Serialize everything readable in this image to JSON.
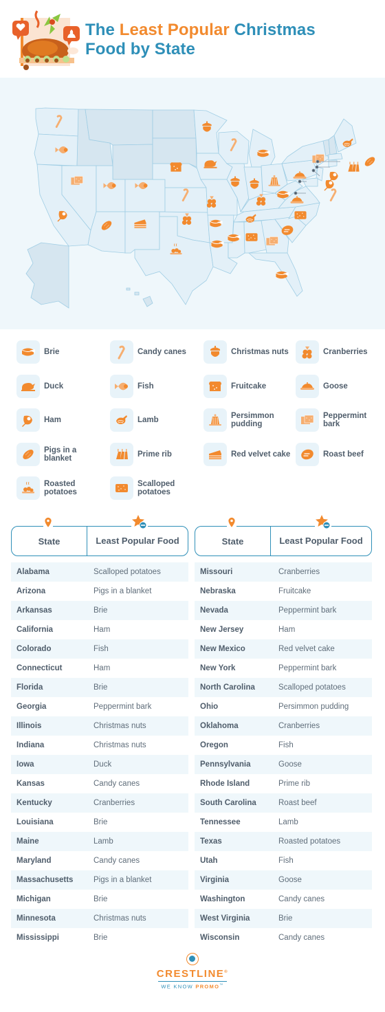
{
  "header": {
    "title_part1": "The ",
    "title_accent": "Least Popular",
    "title_part2": " Christmas",
    "title_line2": "Food by State"
  },
  "colors": {
    "brand_blue": "#2e8fb8",
    "brand_orange": "#f28a2e",
    "light_orange": "#f6ae70",
    "map_bg": "#eff7fb",
    "state_fill": "#e3f0f8",
    "state_nodata": "#d6e6f0"
  },
  "map": {
    "title": "US map of least popular Christmas food by state",
    "markers": [
      {
        "state": "Washington",
        "food": "Candy canes"
      },
      {
        "state": "Oregon",
        "food": "Fish"
      },
      {
        "state": "California",
        "food": "Ham"
      },
      {
        "state": "Nevada",
        "food": "Peppermint bark"
      },
      {
        "state": "Utah",
        "food": "Fish"
      },
      {
        "state": "Colorado",
        "food": "Fish"
      },
      {
        "state": "Arizona",
        "food": "Pigs in a blanket"
      },
      {
        "state": "New Mexico",
        "food": "Red velvet cake"
      },
      {
        "state": "Texas",
        "food": "Roasted potatoes"
      },
      {
        "state": "Oklahoma",
        "food": "Cranberries"
      },
      {
        "state": "Kansas",
        "food": "Candy canes"
      },
      {
        "state": "Nebraska",
        "food": "Fruitcake"
      },
      {
        "state": "Minnesota",
        "food": "Christmas nuts"
      },
      {
        "state": "Iowa",
        "food": "Duck"
      },
      {
        "state": "Missouri",
        "food": "Cranberries"
      },
      {
        "state": "Arkansas",
        "food": "Brie"
      },
      {
        "state": "Louisiana",
        "food": "Brie"
      },
      {
        "state": "Wisconsin",
        "food": "Candy canes"
      },
      {
        "state": "Illinois",
        "food": "Christmas nuts"
      },
      {
        "state": "Michigan",
        "food": "Brie"
      },
      {
        "state": "Indiana",
        "food": "Christmas nuts"
      },
      {
        "state": "Ohio",
        "food": "Persimmon pudding"
      },
      {
        "state": "Kentucky",
        "food": "Cranberries"
      },
      {
        "state": "Tennessee",
        "food": "Lamb"
      },
      {
        "state": "Mississippi",
        "food": "Brie"
      },
      {
        "state": "Alabama",
        "food": "Scalloped potatoes"
      },
      {
        "state": "Georgia",
        "food": "Peppermint bark"
      },
      {
        "state": "Florida",
        "food": "Brie"
      },
      {
        "state": "South Carolina",
        "food": "Roast beef"
      },
      {
        "state": "North Carolina",
        "food": "Scalloped potatoes"
      },
      {
        "state": "Virginia",
        "food": "Goose"
      },
      {
        "state": "West Virginia",
        "food": "Brie"
      },
      {
        "state": "Pennsylvania",
        "food": "Goose"
      },
      {
        "state": "New York",
        "food": "Peppermint bark"
      },
      {
        "state": "Maine",
        "food": "Lamb"
      },
      {
        "state": "Massachusetts",
        "food": "Pigs in a blanket"
      },
      {
        "state": "Rhode Island",
        "food": "Prime rib"
      },
      {
        "state": "Connecticut",
        "food": "Ham"
      },
      {
        "state": "New Jersey",
        "food": "Ham"
      },
      {
        "state": "Maryland",
        "food": "Candy canes"
      }
    ]
  },
  "legend": {
    "items": [
      {
        "label": "Brie",
        "icon": "brie-icon"
      },
      {
        "label": "Candy canes",
        "icon": "candy-cane-icon"
      },
      {
        "label": "Christmas nuts",
        "icon": "acorn-icon"
      },
      {
        "label": "Cranberries",
        "icon": "cranberries-icon"
      },
      {
        "label": "Duck",
        "icon": "duck-icon"
      },
      {
        "label": "Fish",
        "icon": "fish-icon"
      },
      {
        "label": "Fruitcake",
        "icon": "fruitcake-icon"
      },
      {
        "label": "Goose",
        "icon": "goose-icon"
      },
      {
        "label": "Ham",
        "icon": "ham-icon"
      },
      {
        "label": "Lamb",
        "icon": "lamb-icon"
      },
      {
        "label": "Persimmon pudding",
        "icon": "pudding-icon"
      },
      {
        "label": "Peppermint bark",
        "icon": "peppermint-bark-icon"
      },
      {
        "label": "Pigs in a blanket",
        "icon": "pigs-in-blanket-icon"
      },
      {
        "label": "Prime rib",
        "icon": "prime-rib-icon"
      },
      {
        "label": "Red velvet cake",
        "icon": "cake-slice-icon"
      },
      {
        "label": "Roast beef",
        "icon": "roast-beef-icon"
      },
      {
        "label": "Roasted potatoes",
        "icon": "roasted-potatoes-icon"
      },
      {
        "label": "Scalloped potatoes",
        "icon": "scalloped-potatoes-icon"
      }
    ]
  },
  "table": {
    "col_state": "State",
    "col_food": "Least Popular Food",
    "left_rows": [
      {
        "state": "Alabama",
        "food": "Scalloped potatoes"
      },
      {
        "state": "Arizona",
        "food": "Pigs in a blanket"
      },
      {
        "state": "Arkansas",
        "food": "Brie"
      },
      {
        "state": "California",
        "food": "Ham"
      },
      {
        "state": "Colorado",
        "food": "Fish"
      },
      {
        "state": "Connecticut",
        "food": "Ham"
      },
      {
        "state": "Florida",
        "food": "Brie"
      },
      {
        "state": "Georgia",
        "food": "Peppermint bark"
      },
      {
        "state": "Illinois",
        "food": "Christmas nuts"
      },
      {
        "state": "Indiana",
        "food": "Christmas nuts"
      },
      {
        "state": "Iowa",
        "food": "Duck"
      },
      {
        "state": "Kansas",
        "food": "Candy canes"
      },
      {
        "state": "Kentucky",
        "food": "Cranberries"
      },
      {
        "state": "Louisiana",
        "food": "Brie"
      },
      {
        "state": "Maine",
        "food": "Lamb"
      },
      {
        "state": "Maryland",
        "food": "Candy canes"
      },
      {
        "state": "Massachusetts",
        "food": "Pigs in a blanket"
      },
      {
        "state": "Michigan",
        "food": "Brie"
      },
      {
        "state": "Minnesota",
        "food": "Christmas nuts"
      },
      {
        "state": "Mississippi",
        "food": "Brie"
      }
    ],
    "right_rows": [
      {
        "state": "Missouri",
        "food": "Cranberries"
      },
      {
        "state": "Nebraska",
        "food": "Fruitcake"
      },
      {
        "state": "Nevada",
        "food": "Peppermint bark"
      },
      {
        "state": "New Jersey",
        "food": "Ham"
      },
      {
        "state": "New Mexico",
        "food": "Red velvet cake"
      },
      {
        "state": "New York",
        "food": "Peppermint bark"
      },
      {
        "state": "North Carolina",
        "food": "Scalloped potatoes"
      },
      {
        "state": "Ohio",
        "food": "Persimmon pudding"
      },
      {
        "state": "Oklahoma",
        "food": "Cranberries"
      },
      {
        "state": "Oregon",
        "food": "Fish"
      },
      {
        "state": "Pennsylvania",
        "food": "Goose"
      },
      {
        "state": "Rhode Island",
        "food": "Prime rib"
      },
      {
        "state": "South Carolina",
        "food": "Roast beef"
      },
      {
        "state": "Tennessee",
        "food": "Lamb"
      },
      {
        "state": "Texas",
        "food": "Roasted potatoes"
      },
      {
        "state": "Utah",
        "food": "Fish"
      },
      {
        "state": "Virginia",
        "food": "Goose"
      },
      {
        "state": "Washington",
        "food": "Candy canes"
      },
      {
        "state": "West Virginia",
        "food": "Brie"
      },
      {
        "state": "Wisconsin",
        "food": "Candy canes"
      }
    ]
  },
  "footer": {
    "brand": "CRESTLINE",
    "registered": "®",
    "tagline_part1": "WE KNOW ",
    "tagline_part2": "PROMO",
    "tm": "™"
  }
}
